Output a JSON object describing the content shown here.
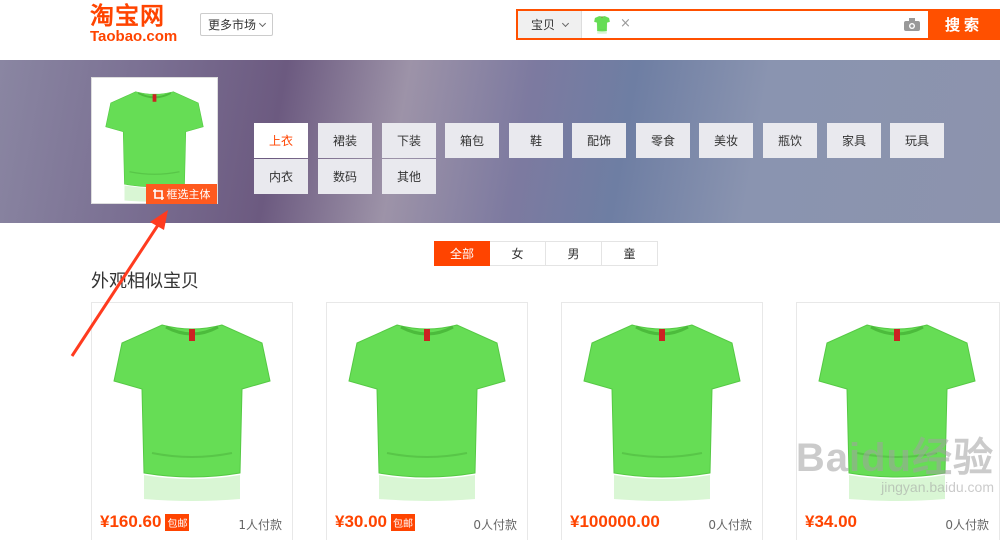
{
  "header": {
    "logo_cn": "淘宝网",
    "logo_en": "Taobao.com",
    "market_label": "更多市场",
    "search_type": "宝贝",
    "search_clear": "×",
    "search_placeholder": "",
    "search_button": "搜索"
  },
  "banner": {
    "crop_label": "框选主体",
    "categories": [
      "上衣",
      "裙装",
      "下装",
      "箱包",
      "鞋",
      "配饰",
      "零食",
      "美妆",
      "瓶饮",
      "家具",
      "玩具",
      "内衣",
      "数码",
      "其他"
    ]
  },
  "gender_tabs": [
    "全部",
    "女",
    "男",
    "童"
  ],
  "section_title": "外观相似宝贝",
  "products": [
    {
      "price": "¥160.60",
      "badge": "包邮",
      "sales": "1人付款"
    },
    {
      "price": "¥30.00",
      "badge": "包邮",
      "sales": "0人付款"
    },
    {
      "price": "¥100000.00",
      "badge": "",
      "sales": "0人付款"
    },
    {
      "price": "¥34.00",
      "badge": "",
      "sales": "0人付款"
    }
  ],
  "watermark": {
    "big": "Baidu经验",
    "small": "jingyan.baidu.com"
  },
  "colors": {
    "accent": "#ff4400",
    "shirt": "#66dd55"
  }
}
